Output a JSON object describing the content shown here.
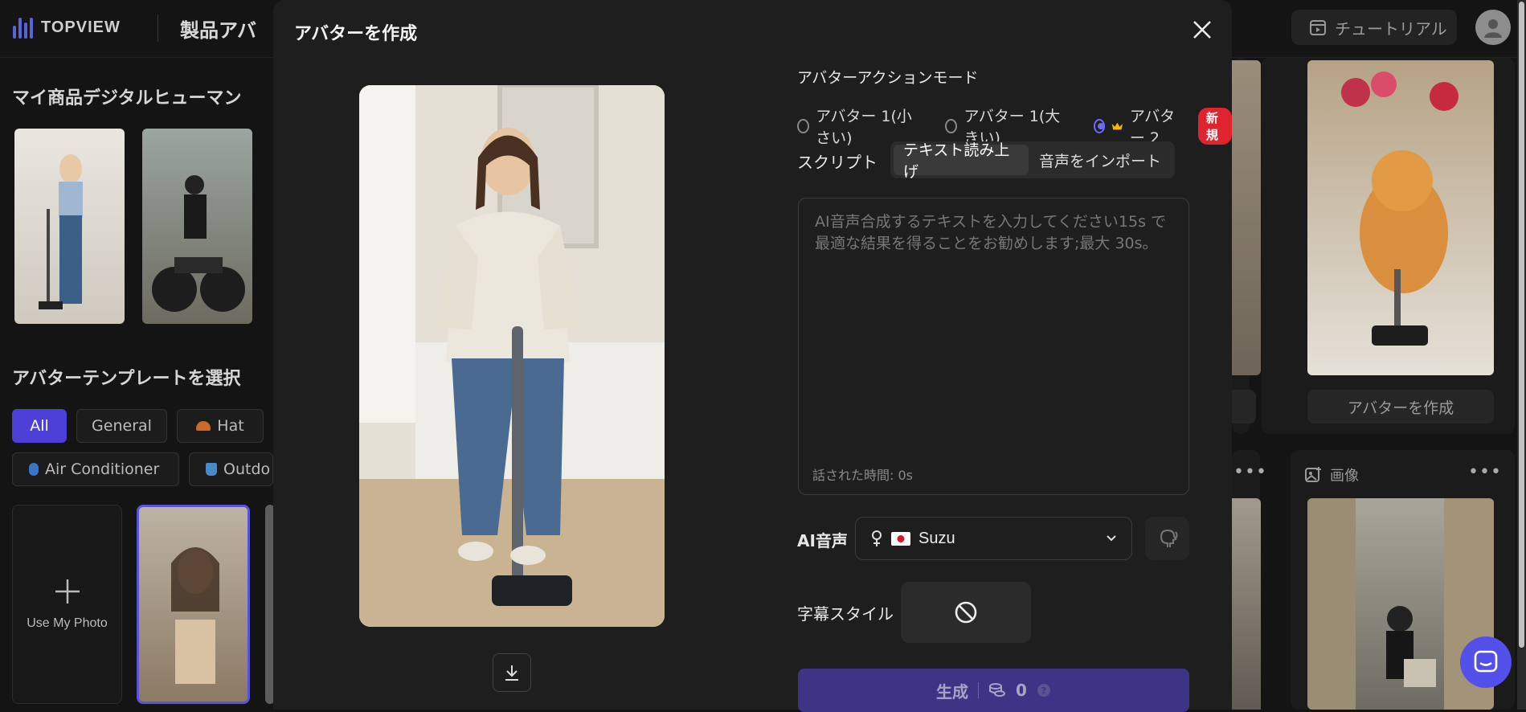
{
  "app": {
    "brand": "TOPVIEW",
    "page_title": "製品アバ",
    "tutorial_label": "チュートリアル"
  },
  "left": {
    "my_products_title": "マイ商品デジタルヒューマン",
    "template_title": "アバターテンプレートを選択",
    "chips": [
      {
        "label": "All"
      },
      {
        "label": "General"
      },
      {
        "label": "Hat"
      },
      {
        "label": "Air Conditioner"
      },
      {
        "label": "Outdo"
      }
    ],
    "use_photo_label": "Use My Photo"
  },
  "right": {
    "create_avatar_label": "アバターを作成",
    "image_section_label": "画像"
  },
  "modal": {
    "title": "アバターを作成",
    "action_mode_label": "アバターアクションモード",
    "modes": [
      {
        "label": "アバター 1(小さい)",
        "selected": false
      },
      {
        "label": "アバター 1(大きい)",
        "selected": false
      },
      {
        "label": "アバター 2",
        "selected": true
      }
    ],
    "new_badge": "新規",
    "script_label": "スクリプト",
    "script_tabs": [
      {
        "label": "テキスト読み上げ",
        "active": true
      },
      {
        "label": "音声をインポート",
        "active": false
      }
    ],
    "textarea_placeholder": "AI音声合成するテキストを入力してください15s で最適な結果を得ることをお勧めします;最大 30s。",
    "spoken_time": "話された時間: 0s",
    "ai_voice_label": "AI音声",
    "voice_name": "Suzu",
    "subtitle_label": "字幕スタイル",
    "generate_label": "生成",
    "credits": "0"
  },
  "colors": {
    "accent": "#5b63d9",
    "primary_button": "#3e3485",
    "new_badge": "#e0242f"
  }
}
